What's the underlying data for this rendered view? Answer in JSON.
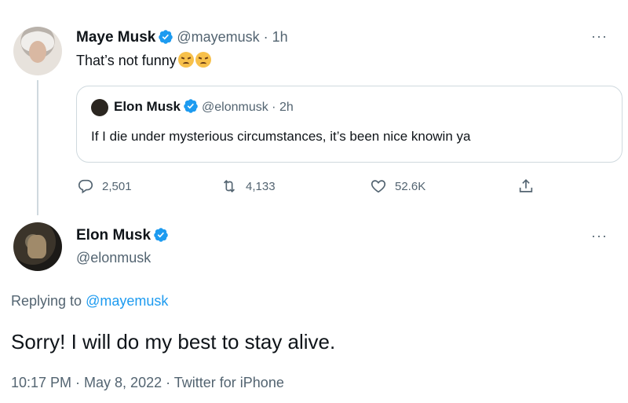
{
  "quote_tweet": {
    "name": "Maye Musk",
    "handle": "@mayemusk",
    "time": "1h",
    "text": "That’s not funny",
    "emojis": [
      "angry-face-icon",
      "angry-face-icon"
    ],
    "quoted": {
      "name": "Elon Musk",
      "handle": "@elonmusk",
      "time": "2h",
      "text": "If I die under mysterious circumstances, it’s been nice knowin ya"
    },
    "stats": {
      "replies": "2,501",
      "retweets": "4,133",
      "likes": "52.6K"
    }
  },
  "reply_tweet": {
    "name": "Elon Musk",
    "handle": "@elonmusk",
    "replying_prefix": "Replying to ",
    "replying_to": "@mayemusk",
    "text": "Sorry! I will do my best to stay alive.",
    "meta": "10:17 PM · May 8, 2022 · Twitter for iPhone"
  },
  "ui": {
    "separator": " · ",
    "more": "···"
  },
  "colors": {
    "accent": "#1d9bf0",
    "secondary_text": "#536471",
    "border": "#cfd9de"
  }
}
